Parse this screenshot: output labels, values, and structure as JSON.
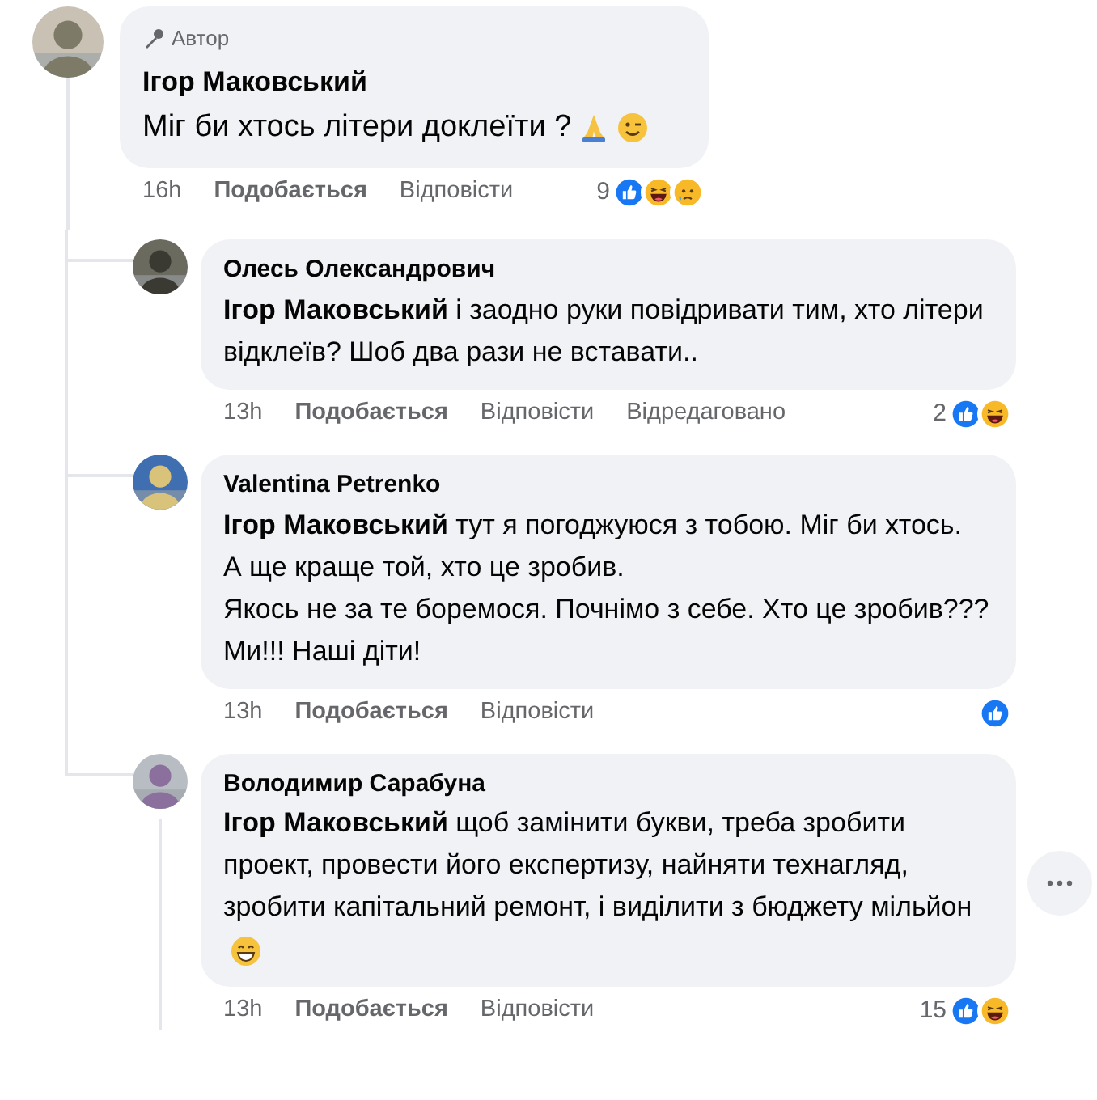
{
  "comment": {
    "badge": "Автор",
    "author": "Ігор Маковський",
    "text": "Міг би хтось літери доклеїти ?",
    "emojis": [
      {
        "kind": "pray"
      },
      {
        "kind": "wink"
      }
    ],
    "meta": {
      "time": "16h",
      "like": "Подобається",
      "reply": "Відповісти",
      "reaction_count": "9",
      "reactions": [
        {
          "kind": "like"
        },
        {
          "kind": "haha"
        },
        {
          "kind": "sad"
        }
      ]
    }
  },
  "replies": [
    {
      "author": "Олесь Олександрович",
      "mention": "Ігор Маковський",
      "paragraphs": [
        "і заодно руки повідривати тим, хто літери відклеїв? Шоб два рази не вставати.."
      ],
      "has_replies": false,
      "more_button": false,
      "meta": {
        "time": "13h",
        "like": "Подобається",
        "reply": "Відповісти",
        "edited": "Відредаговано",
        "reaction_count": "2",
        "reactions": [
          {
            "kind": "like"
          },
          {
            "kind": "haha"
          }
        ]
      }
    },
    {
      "author": "Valentina Petrenko",
      "mention": "Ігор Маковський",
      "paragraphs": [
        "тут я погоджуюся з тобою. Міг би хтось.",
        "А ще краще той, хто це зробив.",
        "Якось не за те боремося. Почнімо з себе. Хто це зробив??? Ми!!! Наші діти!"
      ],
      "has_replies": false,
      "more_button": false,
      "meta": {
        "time": "13h",
        "like": "Подобається",
        "reply": "Відповісти",
        "reactions": [
          {
            "kind": "like"
          }
        ]
      }
    },
    {
      "author": "Володимир Сарабуна",
      "mention": "Ігор Маковський",
      "paragraphs": [
        "щоб замінити букви, треба зробити проект, провести його експертизу, найняти технагляд, зробити капітальний ремонт, і виділити з бюджету мільйон"
      ],
      "emojis": [
        {
          "kind": "grin"
        }
      ],
      "has_replies": true,
      "more_button": true,
      "meta": {
        "time": "13h",
        "like": "Подобається",
        "reply": "Відповісти",
        "reaction_count": "15",
        "reactions": [
          {
            "kind": "like"
          },
          {
            "kind": "haha"
          }
        ]
      }
    }
  ]
}
